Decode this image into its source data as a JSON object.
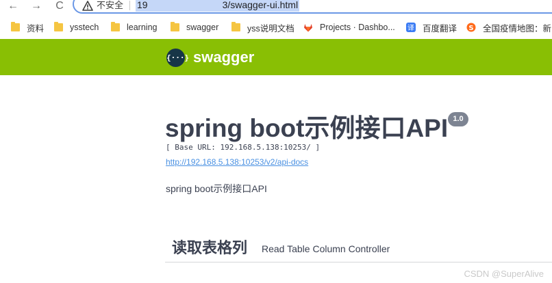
{
  "browser": {
    "nav": {
      "back": "←",
      "forward": "→",
      "reload": "C"
    },
    "security_label": "不安全",
    "url": "19              3/swagger-ui.html",
    "bookmarks": [
      {
        "label": "资料",
        "icon": "folder-icon"
      },
      {
        "label": "ysstech",
        "icon": "folder-icon"
      },
      {
        "label": "learning",
        "icon": "folder-icon"
      },
      {
        "label": "swagger",
        "icon": "folder-icon"
      },
      {
        "label": "yss说明文档",
        "icon": "folder-icon"
      },
      {
        "label": "Projects · Dashbo...",
        "icon": "gitlab-icon"
      },
      {
        "label": "百度翻译",
        "icon": "baidu-translate-icon"
      },
      {
        "label": "全国疫情地图：新...",
        "icon": "sogou-icon"
      }
    ]
  },
  "swagger": {
    "header": {
      "logo_glyph": "{···}",
      "name": "swagger",
      "color": "#89bf04"
    },
    "info": {
      "title": "spring boot示例接口API",
      "version": "1.0",
      "base_url": "[ Base URL: 192.168.5.138:10253/ ]",
      "docs_link": "http://192.168.5.138:10253/v2/api-docs",
      "description": "spring boot示例接口API"
    },
    "tag": {
      "name": "读取表格列",
      "description": "Read Table Column Controller"
    }
  },
  "watermark": "CSDN @SuperAlive"
}
